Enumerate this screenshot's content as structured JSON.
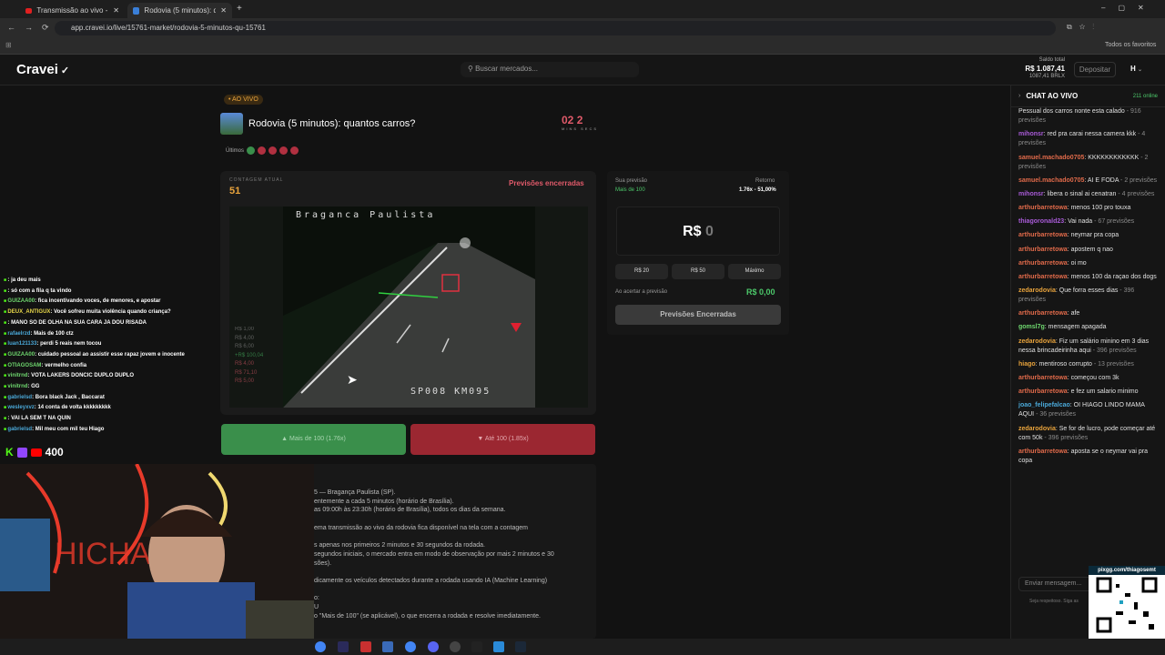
{
  "browser": {
    "tabs": [
      {
        "label": "Transmissão ao vivo - YouTube"
      },
      {
        "label": "Rodovia (5 minutos): quantos c"
      }
    ],
    "url": "app.cravei.io/live/15761-market/rodovia-5-minutos-qu-15761",
    "bookmarks_label": "Todos os favoritos"
  },
  "header": {
    "logo": "Cravei",
    "search_placeholder": "Buscar mercados...",
    "saldo_label": "Saldo total",
    "saldo_value": "R$ 1.087,41",
    "saldo_sub": "1087,41 BRLX",
    "deposit": "Depositar",
    "user_initial": "H"
  },
  "market": {
    "live_badge": "• AO VIVO",
    "title": "Rodovia (5 minutos): quantos carros?",
    "timer_min": "02",
    "timer_sec": "2",
    "timer_min_label": "MINS",
    "timer_sec_label": "SECS",
    "ultimos_label": "Últimos",
    "count_label": "CONTAGEM ATUAL",
    "count_value": "51",
    "status": "Previsões encerradas",
    "video_top_text": "Braganca Paulista",
    "video_bottom_text": "SP008 KM095",
    "up_button": "Mais de 100 (1.76x)",
    "down_button": "Até 100 (1.85x)"
  },
  "side_list": [
    "R$ 1,00",
    "R$ 4,00",
    "R$ 6,00",
    "+R$ 100,04",
    "R$ 4,00",
    "R$ 71,10",
    "R$ 5,00"
  ],
  "prediction": {
    "your_label": "Sua previsão",
    "your_value": "Mais de 100",
    "return_label": "Retorno",
    "return_value": "1.76x - 51,00%",
    "amount_prefix": "R$",
    "amount_value": "0",
    "amt1": "R$ 20",
    "amt2": "R$ 50",
    "amt3": "Máximo",
    "win_label": "Ao acertar a previsão",
    "win_value": "R$ 0,00",
    "closed_button": "Previsões Encerradas"
  },
  "description": [
    "5 — Bragança Paulista (SP).",
    "entemente a cada 5 minutos (horário de Brasília).",
    "as 09:00h às 23:30h (horário de Brasília), todos os dias da semana.",
    "",
    "ema transmissão ao vivo da rodovia fica disponível na tela com a contagem",
    "",
    "s apenas nos primeiros 2 minutos e 30 segundos da rodada.",
    "segundos iniciais, o mercado entra em modo de observação por mais 2 minutos e 30",
    "sões).",
    "",
    "dicamente os veículos detectados durante a rodada usando IA (Machine Learning)",
    "",
    "o:",
    "U",
    "o \"Mais de 100\" (se aplicável), o que encerra a rodada e resolve imediatamente."
  ],
  "chat": {
    "title": "CHAT AO VIVO",
    "online": "211 online",
    "input_placeholder": "Enviar mensagem...",
    "footer": "Seja respeitoso. Siga as",
    "qr_label": "pixgg.com/thiagosemt",
    "messages": [
      {
        "user": "",
        "text": "Pessual dos carros nonte esta calado",
        "meta": " - 916 previsões",
        "color": "#6f6fd8"
      },
      {
        "user": "mihonsr",
        "text": ": red pra carai nessa camera kkk",
        "meta": " - 4 previsões",
        "color": "#a95bd8"
      },
      {
        "user": "samuel.machado0705",
        "text": ": KKKKKKKKKKKK",
        "meta": " - 2 previsões",
        "color": "#e06a4a"
      },
      {
        "user": "samuel.machado0705",
        "text": ": AI E FODA",
        "meta": " - 2 previsões",
        "color": "#e06a4a"
      },
      {
        "user": "mihonsr",
        "text": ": libera o sinal ai cenatran",
        "meta": " - 4 previsões",
        "color": "#a95bd8"
      },
      {
        "user": "arthurbarretowa",
        "text": ": menos 100 pro touxa",
        "meta": "",
        "color": "#e06a4a"
      },
      {
        "user": "thiagoronald23",
        "text": ": Vai nada",
        "meta": " - 67 previsões",
        "color": "#a95bd8"
      },
      {
        "user": "arthurbarretowa",
        "text": ": neymar pra copa",
        "meta": "",
        "color": "#e06a4a"
      },
      {
        "user": "arthurbarretowa",
        "text": ": apostem q nao",
        "meta": "",
        "color": "#e06a4a"
      },
      {
        "user": "arthurbarretowa",
        "text": ": oi mo",
        "meta": "",
        "color": "#e06a4a"
      },
      {
        "user": "arthurbarretowa",
        "text": ": menos 100 da raçao dos dogs",
        "meta": "",
        "color": "#e06a4a"
      },
      {
        "user": "zedarodovia",
        "text": ": Que forra esses dias",
        "meta": " - 396 previsões",
        "color": "#e8a33c"
      },
      {
        "user": "arthurbarretowa",
        "text": ": afe",
        "meta": "",
        "color": "#e06a4a"
      },
      {
        "user": "gomsl7g",
        "text": ": mensagem apagada",
        "meta": "",
        "color": "#6fd86f"
      },
      {
        "user": "zedarodovia",
        "text": ": Fiz um salário minino em 3 dias nessa brincadeirinha aqui",
        "meta": " - 396 previsões",
        "color": "#e8a33c"
      },
      {
        "user": "hiago",
        "text": ": mentiroso corrupto",
        "meta": " - 13 previsões",
        "color": "#e8a33c"
      },
      {
        "user": "arthurbarretowa",
        "text": ": começou com 3k",
        "meta": "",
        "color": "#e06a4a"
      },
      {
        "user": "arthurbarretowa",
        "text": ": e fez um salario minimo",
        "meta": "",
        "color": "#e06a4a"
      },
      {
        "user": "joao_felipefalcao",
        "text": ": OI HIAGO LINDO MAMA AQUI",
        "meta": " - 36 previsões",
        "color": "#4aa8d8"
      },
      {
        "user": "zedarodovia",
        "text": ": Se for de lucro, pode começar até com 50k",
        "meta": " - 396 previsões",
        "color": "#e8a33c"
      },
      {
        "user": "arthurbarretowa",
        "text": ": aposta se o neymar vai pra copa",
        "meta": "",
        "color": "#e06a4a"
      }
    ]
  },
  "overlay_chat": [
    {
      "user": "",
      "text": ": ja deu mais",
      "color": "#e06a6a"
    },
    {
      "user": "",
      "text": ": só com a fila q ta vindo",
      "color": "#e06a6a"
    },
    {
      "user": "GUIZAA00",
      "text": ": fica incentivando voces, de menores, e apostar",
      "color": "#6fd86f"
    },
    {
      "user": "DEUX_ANTIGUX",
      "text": ": Você sofreu muita violência quando criança?",
      "color": "#e8d84a"
    },
    {
      "user": "",
      "text": ": MANO SO DE OLHA NA SUA CARA JA DOU RISADA",
      "color": "#a95bd8"
    },
    {
      "user": "rafaelrzd",
      "text": ": Mais de 100 ctz",
      "color": "#4aa8d8"
    },
    {
      "user": "luan121133",
      "text": ": perdi 5 reais nem tocou",
      "color": "#4aa8d8"
    },
    {
      "user": "GUIZAA00",
      "text": ": cuidado pessoal ao assistir esse rapaz jovem e inocente",
      "color": "#6fd86f"
    },
    {
      "user": "OTIAGOSAM",
      "text": ": vermelho confia",
      "color": "#6fd86f"
    },
    {
      "user": "vinitrnd",
      "text": ": VOTA LAKERS DONCIC DUPLO DUPLO",
      "color": "#6fd86f"
    },
    {
      "user": "vinitrnd",
      "text": ": GG",
      "color": "#6fd86f"
    },
    {
      "user": "gabrielsd",
      "text": ": Bora black Jack , Baccarat",
      "color": "#4aa8d8"
    },
    {
      "user": "wesleyxvz",
      "text": ": 14 conta de volta kkkkkkkkk",
      "color": "#4aa8d8"
    },
    {
      "user": "",
      "text": ": VAI LA SEM T NA QUIN",
      "color": "#a95bd8"
    },
    {
      "user": "gabrielsd",
      "text": ": Mil meu com mil teu Hiago",
      "color": "#4aa8d8"
    }
  ],
  "viewer_count": "400",
  "colors": {
    "accent_green": "#3a8f4b",
    "accent_red": "#9b2731",
    "live_orange": "#e8a33c"
  }
}
